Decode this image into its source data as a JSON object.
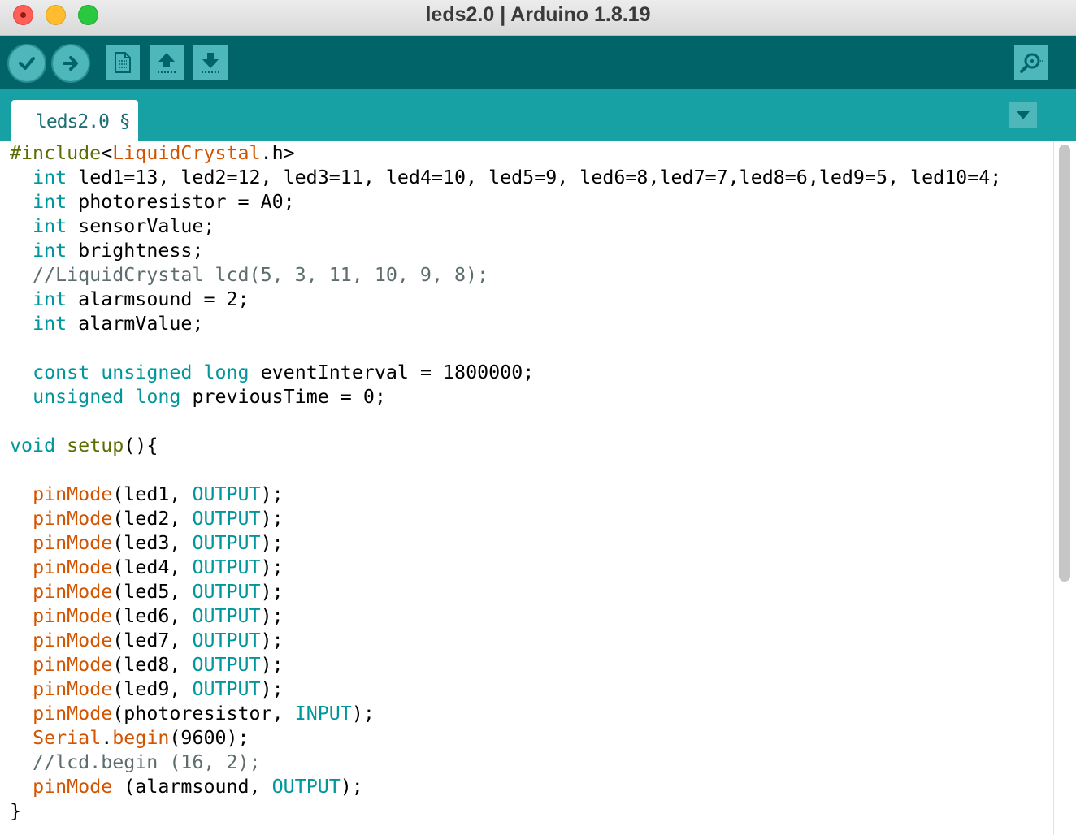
{
  "window": {
    "title": "leds2.0 | Arduino 1.8.19"
  },
  "toolbar": {
    "buttons": [
      {
        "name": "verify",
        "icon": "checkmark-icon"
      },
      {
        "name": "upload",
        "icon": "arrow-right-icon"
      },
      {
        "name": "new",
        "icon": "document-icon"
      },
      {
        "name": "open",
        "icon": "arrow-up-icon"
      },
      {
        "name": "save",
        "icon": "arrow-down-icon"
      },
      {
        "name": "serial-monitor",
        "icon": "magnifier-icon"
      }
    ],
    "colors": {
      "bar": "#006468",
      "button": "#4db7bb"
    }
  },
  "tabs": [
    {
      "label": "leds2.0 §",
      "active": true
    }
  ],
  "editor": {
    "colors": {
      "keyword": "#00979c",
      "function": "#d35400",
      "comment": "#5e6d6e",
      "text": "#000000",
      "preprocessor": "#5e6d03"
    },
    "lines": [
      [
        {
          "t": "#include",
          "c": "pp"
        },
        {
          "t": "<",
          "c": "tx"
        },
        {
          "t": "LiquidCrystal",
          "c": "fn"
        },
        {
          "t": ".h>",
          "c": "tx"
        }
      ],
      [
        {
          "t": "  ",
          "c": "tx"
        },
        {
          "t": "int",
          "c": "kw"
        },
        {
          "t": " led1=13, led2=12, led3=11, led4=10, led5=9, led6=8,led7=7,led8=6,led9=5, led10=4;",
          "c": "tx"
        }
      ],
      [
        {
          "t": "  ",
          "c": "tx"
        },
        {
          "t": "int",
          "c": "kw"
        },
        {
          "t": " photoresistor = A0;",
          "c": "tx"
        }
      ],
      [
        {
          "t": "  ",
          "c": "tx"
        },
        {
          "t": "int",
          "c": "kw"
        },
        {
          "t": " sensorValue;",
          "c": "tx"
        }
      ],
      [
        {
          "t": "  ",
          "c": "tx"
        },
        {
          "t": "int",
          "c": "kw"
        },
        {
          "t": " brightness;",
          "c": "tx"
        }
      ],
      [
        {
          "t": "  //LiquidCrystal lcd(5, 3, 11, 10, 9, 8);",
          "c": "cm"
        }
      ],
      [
        {
          "t": "  ",
          "c": "tx"
        },
        {
          "t": "int",
          "c": "kw"
        },
        {
          "t": " alarmsound = 2;",
          "c": "tx"
        }
      ],
      [
        {
          "t": "  ",
          "c": "tx"
        },
        {
          "t": "int",
          "c": "kw"
        },
        {
          "t": " alarmValue;",
          "c": "tx"
        }
      ],
      [
        {
          "t": "",
          "c": "tx"
        }
      ],
      [
        {
          "t": "  ",
          "c": "tx"
        },
        {
          "t": "const",
          "c": "kw"
        },
        {
          "t": " ",
          "c": "tx"
        },
        {
          "t": "unsigned",
          "c": "kw"
        },
        {
          "t": " ",
          "c": "tx"
        },
        {
          "t": "long",
          "c": "kw"
        },
        {
          "t": " eventInterval = 1800000;",
          "c": "tx"
        }
      ],
      [
        {
          "t": "  ",
          "c": "tx"
        },
        {
          "t": "unsigned",
          "c": "kw"
        },
        {
          "t": " ",
          "c": "tx"
        },
        {
          "t": "long",
          "c": "kw"
        },
        {
          "t": " previousTime = 0;",
          "c": "tx"
        }
      ],
      [
        {
          "t": "",
          "c": "tx"
        }
      ],
      [
        {
          "t": "void",
          "c": "kw"
        },
        {
          "t": " ",
          "c": "tx"
        },
        {
          "t": "setup",
          "c": "pp"
        },
        {
          "t": "(){",
          "c": "tx"
        }
      ],
      [
        {
          "t": "",
          "c": "tx"
        }
      ],
      [
        {
          "t": "  ",
          "c": "tx"
        },
        {
          "t": "pinMode",
          "c": "fn"
        },
        {
          "t": "(led1, ",
          "c": "tx"
        },
        {
          "t": "OUTPUT",
          "c": "kw"
        },
        {
          "t": ");",
          "c": "tx"
        }
      ],
      [
        {
          "t": "  ",
          "c": "tx"
        },
        {
          "t": "pinMode",
          "c": "fn"
        },
        {
          "t": "(led2, ",
          "c": "tx"
        },
        {
          "t": "OUTPUT",
          "c": "kw"
        },
        {
          "t": ");",
          "c": "tx"
        }
      ],
      [
        {
          "t": "  ",
          "c": "tx"
        },
        {
          "t": "pinMode",
          "c": "fn"
        },
        {
          "t": "(led3, ",
          "c": "tx"
        },
        {
          "t": "OUTPUT",
          "c": "kw"
        },
        {
          "t": ");",
          "c": "tx"
        }
      ],
      [
        {
          "t": "  ",
          "c": "tx"
        },
        {
          "t": "pinMode",
          "c": "fn"
        },
        {
          "t": "(led4, ",
          "c": "tx"
        },
        {
          "t": "OUTPUT",
          "c": "kw"
        },
        {
          "t": ");",
          "c": "tx"
        }
      ],
      [
        {
          "t": "  ",
          "c": "tx"
        },
        {
          "t": "pinMode",
          "c": "fn"
        },
        {
          "t": "(led5, ",
          "c": "tx"
        },
        {
          "t": "OUTPUT",
          "c": "kw"
        },
        {
          "t": ");",
          "c": "tx"
        }
      ],
      [
        {
          "t": "  ",
          "c": "tx"
        },
        {
          "t": "pinMode",
          "c": "fn"
        },
        {
          "t": "(led6, ",
          "c": "tx"
        },
        {
          "t": "OUTPUT",
          "c": "kw"
        },
        {
          "t": ");",
          "c": "tx"
        }
      ],
      [
        {
          "t": "  ",
          "c": "tx"
        },
        {
          "t": "pinMode",
          "c": "fn"
        },
        {
          "t": "(led7, ",
          "c": "tx"
        },
        {
          "t": "OUTPUT",
          "c": "kw"
        },
        {
          "t": ");",
          "c": "tx"
        }
      ],
      [
        {
          "t": "  ",
          "c": "tx"
        },
        {
          "t": "pinMode",
          "c": "fn"
        },
        {
          "t": "(led8, ",
          "c": "tx"
        },
        {
          "t": "OUTPUT",
          "c": "kw"
        },
        {
          "t": ");",
          "c": "tx"
        }
      ],
      [
        {
          "t": "  ",
          "c": "tx"
        },
        {
          "t": "pinMode",
          "c": "fn"
        },
        {
          "t": "(led9, ",
          "c": "tx"
        },
        {
          "t": "OUTPUT",
          "c": "kw"
        },
        {
          "t": ");",
          "c": "tx"
        }
      ],
      [
        {
          "t": "  ",
          "c": "tx"
        },
        {
          "t": "pinMode",
          "c": "fn"
        },
        {
          "t": "(photoresistor, ",
          "c": "tx"
        },
        {
          "t": "INPUT",
          "c": "kw"
        },
        {
          "t": ");",
          "c": "tx"
        }
      ],
      [
        {
          "t": "  ",
          "c": "tx"
        },
        {
          "t": "Serial",
          "c": "fn"
        },
        {
          "t": ".",
          "c": "tx"
        },
        {
          "t": "begin",
          "c": "fn"
        },
        {
          "t": "(9600);",
          "c": "tx"
        }
      ],
      [
        {
          "t": "  //lcd.begin (16, 2);",
          "c": "cm"
        }
      ],
      [
        {
          "t": "  ",
          "c": "tx"
        },
        {
          "t": "pinMode",
          "c": "fn"
        },
        {
          "t": " (alarmsound, ",
          "c": "tx"
        },
        {
          "t": "OUTPUT",
          "c": "kw"
        },
        {
          "t": ");",
          "c": "tx"
        }
      ],
      [
        {
          "t": "}",
          "c": "tx"
        }
      ]
    ]
  }
}
